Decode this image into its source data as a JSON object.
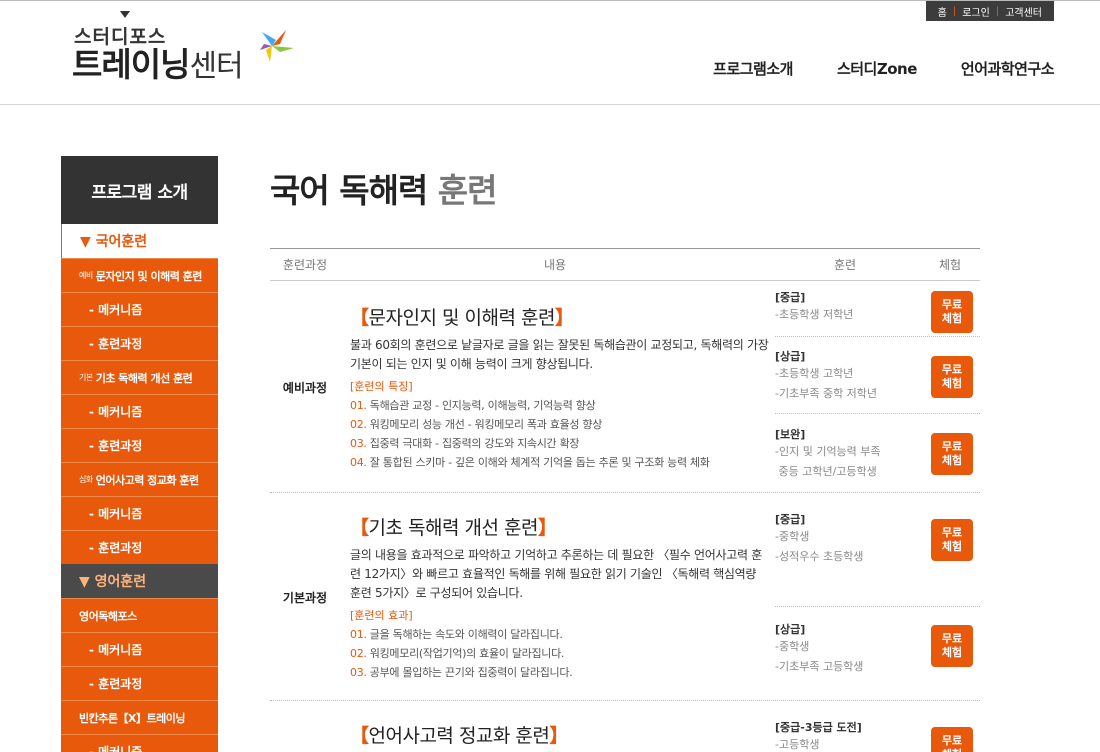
{
  "util": {
    "home": "홈",
    "login": "로그인",
    "support": "고객센터"
  },
  "logo": {
    "top": "스터디포스",
    "main_bold": "트레이닝",
    "main_thin": "센터"
  },
  "gnb": [
    "프로그램소개",
    "스터디Zone",
    "언어과학연구소"
  ],
  "sidebar": {
    "title": "프로그램 소개",
    "korean": "▼ 국어훈련",
    "english": "▼ 영어훈련",
    "tag_pre": "예비",
    "tag_basic": "기본",
    "tag_deep": "심화",
    "c1": "문자인지 및 이해력 훈련",
    "c2": "기초 독해력 개선 훈련",
    "c3": "언어사고력 정교화 훈련",
    "mechanism": "- 메커니즘",
    "process": "- 훈련과정",
    "e1": "영어독해포스",
    "e2": "빈칸추론【X】트레이닝"
  },
  "main": {
    "title_bold": "국어 독해력",
    "title_light": "훈련",
    "headers": {
      "course": "훈련과정",
      "content": "내용",
      "training": "훈련",
      "trial": "체험"
    }
  },
  "rows": [
    {
      "label": "예비과정",
      "title": "문자인지 및 이해력 훈련",
      "desc": "불과 60회의 훈련으로 낱글자로 글을 읽는 잘못된 독해습관이 교정되고, 독해력의 가장 기본이 되는 인지 및 이해 능력이 크게 향상됩니다.",
      "feat_head": "[훈련의 특징]",
      "feats": [
        {
          "num": "01.",
          "text": " 독해습관 교정 - 인지능력, 이해능력, 기억능력 향상"
        },
        {
          "num": "02.",
          "text": " 워킹메모리 성능 개선 - 워킹메모리 폭과 효율성 향상"
        },
        {
          "num": "03.",
          "text": " 집중력 극대화 - 집중력의 강도와 지속시간 확장"
        },
        {
          "num": "04.",
          "text": " 잘 통합된 스키마 - 깊은 이해와 체계적 기억을 돕는 추론 및 구조화 능력 체화"
        }
      ],
      "trains": [
        {
          "level": "[중급]",
          "targets": [
            "-초등학생 저학년"
          ],
          "button": "무료\n체험"
        },
        {
          "level": "[상급]",
          "targets": [
            "-초등학생 고학년",
            "-기초부족 중학 저학년"
          ],
          "button": "무료\n체험"
        },
        {
          "level": "[보완]",
          "targets": [
            "-인지 및 기억능력 부족",
            " 중등 고학년/고등학생"
          ],
          "button": "무료\n체험"
        }
      ]
    },
    {
      "label": "기본과정",
      "title": "기초 독해력 개선 훈련",
      "desc": "글의 내용을 효과적으로 파악하고 기억하고 추론하는 데 필요한 〈필수 언어사고력 훈련 12가지〉와 빠르고 효율적인 독해를 위해 필요한 읽기 기술인 〈독해력 핵심역량 훈련 5가지〉로 구성되어 있습니다.",
      "feat_head": "[훈련의 효과]",
      "feats": [
        {
          "num": "01.",
          "text": " 글을 독해하는 속도와 이해력이 달라집니다."
        },
        {
          "num": "02.",
          "text": " 워킹메모리(작업기억)의 효율이 달라집니다."
        },
        {
          "num": "03.",
          "text": " 공부에 몰입하는 끈기와 집중력이 달라집니다."
        }
      ],
      "trains": [
        {
          "level": "[중급]",
          "targets": [
            "-중학생",
            "-성적우수 초등학생"
          ],
          "button": "무료\n체험"
        },
        {
          "level": "[상급]",
          "targets": [
            "-중학생",
            "-기초부족 고등학생"
          ],
          "button": "무료\n체험"
        }
      ]
    },
    {
      "title": "언어사고력 정교화 훈련",
      "trains": [
        {
          "level": "[중급-3등급 도전]",
          "targets": [
            "-고등학생"
          ],
          "button": "무료\n체험"
        }
      ]
    }
  ],
  "colors": {
    "accent": "#e8590c",
    "dark": "#333333"
  }
}
